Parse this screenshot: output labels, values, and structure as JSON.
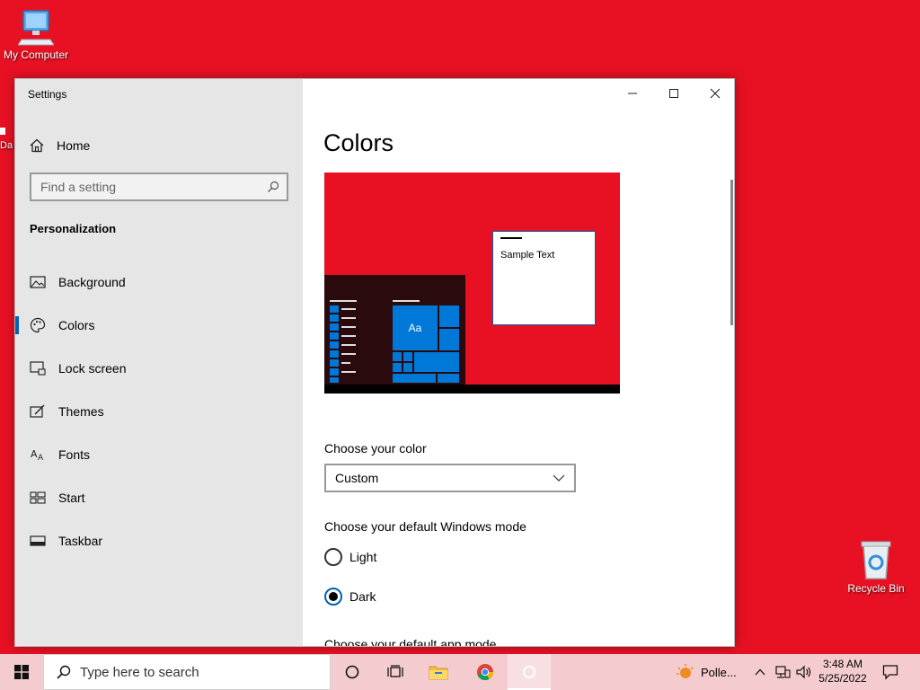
{
  "desktop": {
    "my_computer_label": "My Computer",
    "partial_icon_label": "Da",
    "recycle_bin_label": "Recycle Bin"
  },
  "window": {
    "title": "Settings",
    "sidebar": {
      "home_label": "Home",
      "search_placeholder": "Find a setting",
      "section_title": "Personalization",
      "items": [
        {
          "label": "Background",
          "icon": "picture-icon"
        },
        {
          "label": "Colors",
          "icon": "palette-icon",
          "active": true
        },
        {
          "label": "Lock screen",
          "icon": "lock-screen-icon"
        },
        {
          "label": "Themes",
          "icon": "themes-icon"
        },
        {
          "label": "Fonts",
          "icon": "font-icon"
        },
        {
          "label": "Start",
          "icon": "start-icon"
        },
        {
          "label": "Taskbar",
          "icon": "taskbar-icon"
        }
      ]
    },
    "main": {
      "title": "Colors",
      "preview": {
        "sample_text": "Sample Text",
        "tile_text": "Aa"
      },
      "choose_color_label": "Choose your color",
      "color_dropdown_value": "Custom",
      "windows_mode_label": "Choose your default Windows mode",
      "windows_mode_options": [
        "Light",
        "Dark"
      ],
      "windows_mode_selected": "Dark",
      "app_mode_label": "Choose your default app mode"
    }
  },
  "taskbar": {
    "search_placeholder": "Type here to search",
    "weather_label": "Polle...",
    "time": "3:48 AM",
    "date": "5/25/2022"
  },
  "colors": {
    "accent": "#e81123",
    "highlight": "#0078d7",
    "sidebar_bg": "#e6e6e6"
  }
}
